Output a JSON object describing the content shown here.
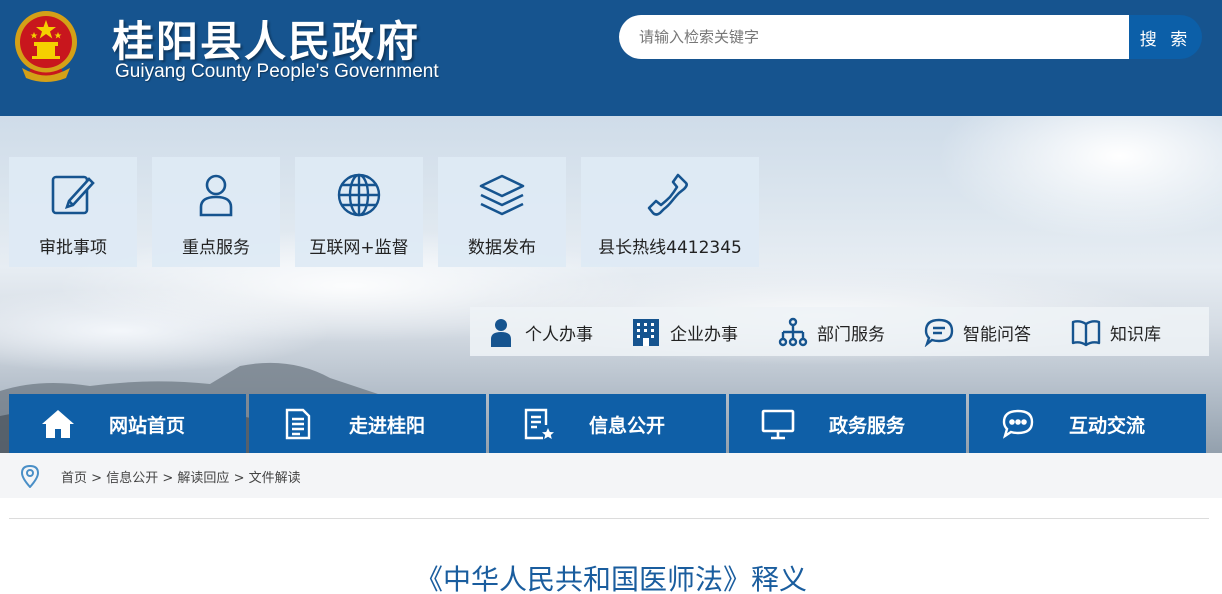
{
  "header": {
    "title": "桂阳县人民政府",
    "subtitle": "Guiyang County People's Government",
    "emblem_icon": "national-emblem-icon",
    "search": {
      "placeholder": "请输入检索关键字",
      "button_label": "搜 索"
    },
    "colors": {
      "header_bg": "#16548f",
      "search_button": "#0c5fa8"
    }
  },
  "tiles": [
    {
      "label": "审批事项",
      "icon": "edit-icon"
    },
    {
      "label": "重点服务",
      "icon": "user-icon"
    },
    {
      "label": "互联网+监督",
      "icon": "globe-icon"
    },
    {
      "label": "数据发布",
      "icon": "layers-icon"
    },
    {
      "label": "县长热线4412345",
      "icon": "phone-icon"
    }
  ],
  "quick_links": [
    {
      "label": "个人办事",
      "icon": "person-icon"
    },
    {
      "label": "企业办事",
      "icon": "building-icon"
    },
    {
      "label": "部门服务",
      "icon": "org-chart-icon"
    },
    {
      "label": "智能问答",
      "icon": "chat-icon"
    },
    {
      "label": "知识库",
      "icon": "book-icon"
    }
  ],
  "nav": [
    {
      "label": "网站首页",
      "icon": "home-icon"
    },
    {
      "label": "走进桂阳",
      "icon": "document-icon"
    },
    {
      "label": "信息公开",
      "icon": "info-doc-icon"
    },
    {
      "label": "政务服务",
      "icon": "monitor-icon"
    },
    {
      "label": "互动交流",
      "icon": "chat-bubbles-icon"
    }
  ],
  "breadcrumb": {
    "icon": "location-pin-icon",
    "items": [
      "首页",
      "信息公开",
      "解读回应",
      "文件解读"
    ],
    "separator": ">"
  },
  "article": {
    "title": "《中华人民共和国医师法》释义"
  },
  "colors": {
    "nav_bg": "#0f5fa7",
    "title": "#1a5d9e",
    "icon_blue": "#16548f"
  }
}
